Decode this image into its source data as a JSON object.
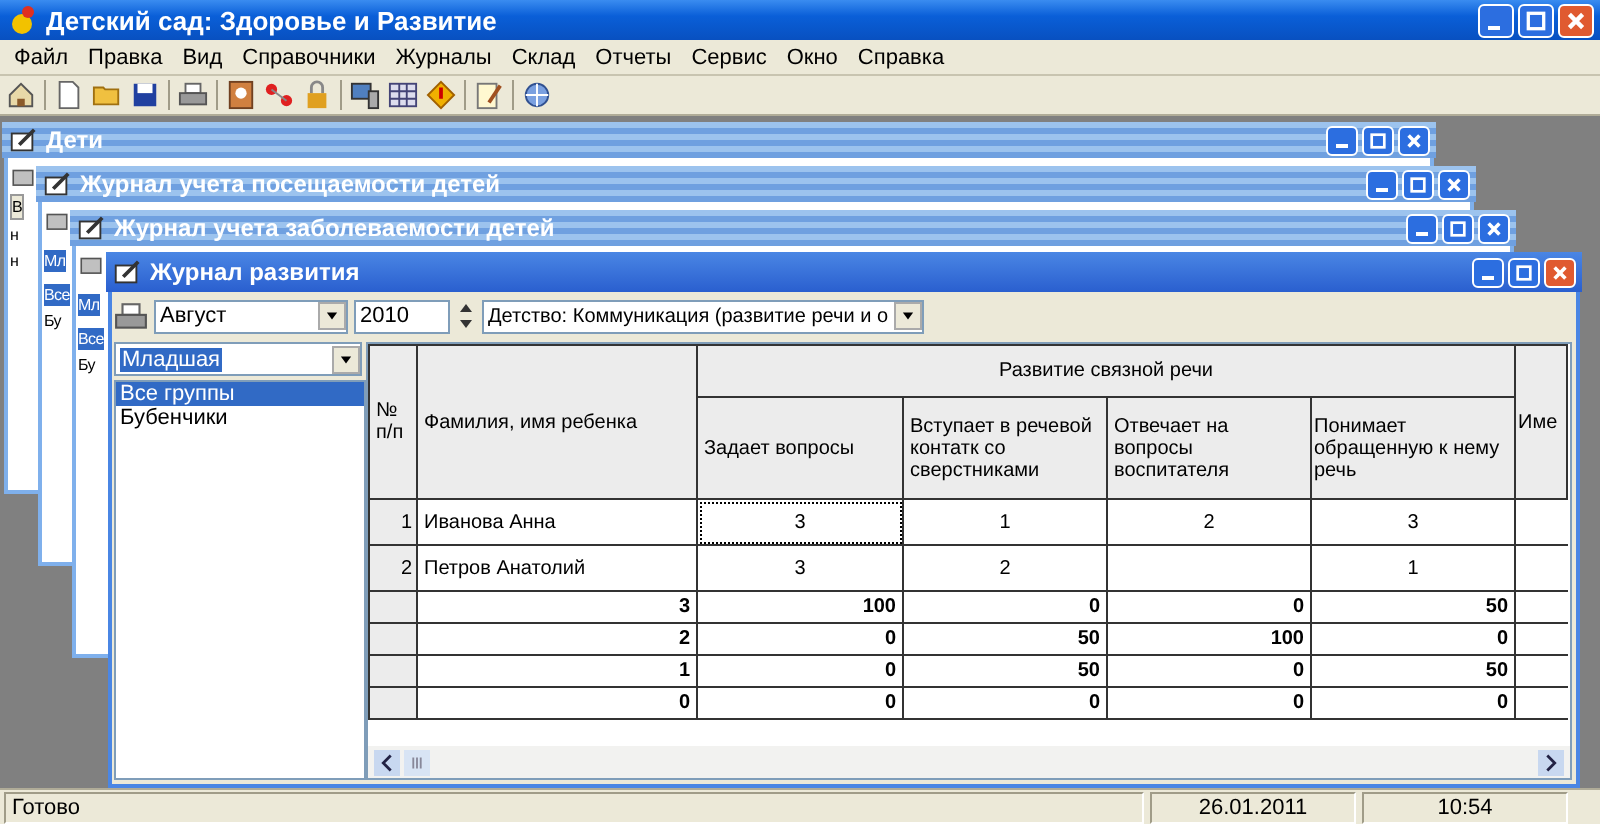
{
  "window": {
    "title": "Детский сад: Здоровье и Развитие"
  },
  "menu": [
    "Файл",
    "Правка",
    "Вид",
    "Справочники",
    "Журналы",
    "Склад",
    "Отчеты",
    "Сервис",
    "Окно",
    "Справка"
  ],
  "mdi_windows": [
    {
      "title": "Дети",
      "active": false,
      "strip": [
        {
          "kind": "header",
          "text": "В"
        },
        {
          "kind": "row",
          "text": "н",
          "selected": false
        },
        {
          "kind": "row",
          "text": "н",
          "selected": false
        }
      ]
    },
    {
      "title": "Журнал учета посещаемости детей",
      "active": false,
      "strip": [
        {
          "kind": "combo",
          "text": "Мл"
        },
        {
          "kind": "row",
          "text": "Все",
          "selected": true
        },
        {
          "kind": "row",
          "text": "Бу",
          "selected": false
        }
      ]
    },
    {
      "title": "Журнал учета заболеваемости детей",
      "active": false,
      "strip": [
        {
          "kind": "combo",
          "text": "Мл"
        },
        {
          "kind": "row",
          "text": "Все",
          "selected": true
        },
        {
          "kind": "row",
          "text": "Бу",
          "selected": false
        }
      ]
    }
  ],
  "active_window": {
    "title": "Журнал развития",
    "active": true,
    "month": {
      "value": "Август"
    },
    "year": {
      "value": "2010"
    },
    "section": {
      "value": "Детство: Коммуникация (развитие речи и о"
    },
    "group": {
      "value": "Младшая"
    },
    "groups": [
      {
        "label": "Все группы",
        "selected": true
      },
      {
        "label": "Бубенчики",
        "selected": false
      }
    ],
    "table": {
      "num_header": "№ п/п",
      "name_header": "Фамилия, имя ребенка",
      "group_header": "Развитие связной речи",
      "columns": [
        "Задает вопросы",
        "Вступает в речевой контатк со сверстниками",
        "Отвечает на вопросы воспитателя",
        "Понимает обращенную к нему речь"
      ],
      "column_5": "Име",
      "rows": [
        {
          "num": "1",
          "name": "Иванова Анна",
          "cells": [
            "3",
            "1",
            "2",
            "3"
          ]
        },
        {
          "num": "2",
          "name": "Петров Анатолий",
          "cells": [
            "3",
            "2",
            null,
            "1"
          ]
        }
      ],
      "summary": [
        {
          "score": "3",
          "cells": [
            "100",
            "0",
            "0",
            "50"
          ]
        },
        {
          "score": "2",
          "cells": [
            "0",
            "50",
            "100",
            "0"
          ]
        },
        {
          "score": "1",
          "cells": [
            "0",
            "50",
            "0",
            "50"
          ]
        },
        {
          "score": "0",
          "cells": [
            "0",
            "0",
            "0",
            "0"
          ]
        }
      ]
    }
  },
  "status_bar": {
    "message": "Готово",
    "date": "26.01.2011",
    "time": "10:54"
  }
}
